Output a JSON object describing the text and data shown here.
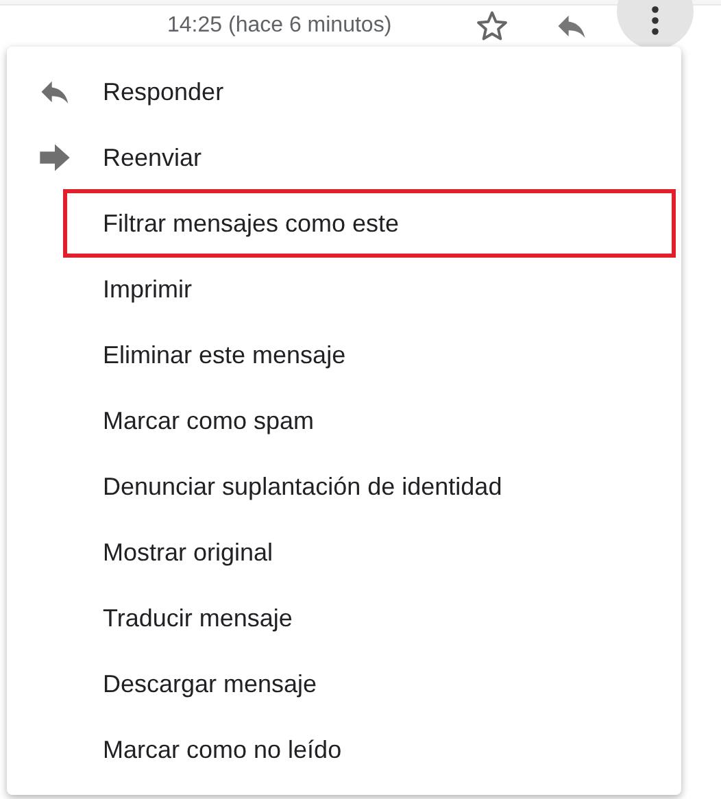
{
  "header": {
    "time": "14:25 (hace 6 minutos)",
    "starred": false
  },
  "menu": [
    {
      "label": "Responder",
      "kind": "reply",
      "highlighted": false
    },
    {
      "label": "Reenviar",
      "kind": "forward",
      "highlighted": false
    },
    {
      "label": "Filtrar mensajes como este",
      "kind": "plain",
      "highlighted": true
    },
    {
      "label": "Imprimir",
      "kind": "plain",
      "highlighted": false
    },
    {
      "label": "Eliminar este mensaje",
      "kind": "plain",
      "highlighted": false
    },
    {
      "label": "Marcar como spam",
      "kind": "plain",
      "highlighted": false
    },
    {
      "label": "Denunciar suplantación de identidad",
      "kind": "plain",
      "highlighted": false
    },
    {
      "label": "Mostrar original",
      "kind": "plain",
      "highlighted": false
    },
    {
      "label": "Traducir mensaje",
      "kind": "plain",
      "highlighted": false
    },
    {
      "label": "Descargar mensaje",
      "kind": "plain",
      "highlighted": false
    },
    {
      "label": "Marcar como no leído",
      "kind": "plain",
      "highlighted": false
    }
  ]
}
